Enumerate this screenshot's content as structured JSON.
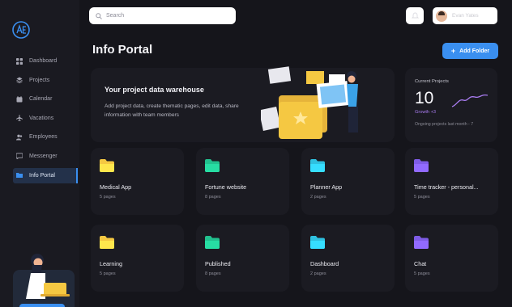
{
  "app": {
    "logo_text": "AE"
  },
  "sidebar": {
    "items": [
      {
        "label": "Dashboard",
        "icon": "grid-icon",
        "active": false
      },
      {
        "label": "Projects",
        "icon": "layers-icon",
        "active": false
      },
      {
        "label": "Calendar",
        "icon": "calendar-icon",
        "active": false
      },
      {
        "label": "Vacations",
        "icon": "airplane-icon",
        "active": false
      },
      {
        "label": "Employees",
        "icon": "users-icon",
        "active": false
      },
      {
        "label": "Messenger",
        "icon": "chat-icon",
        "active": false
      },
      {
        "label": "Info Portal",
        "icon": "folder-icon",
        "active": true
      }
    ]
  },
  "header": {
    "search_placeholder": "Search",
    "user_name": "Evan Yates"
  },
  "main": {
    "title": "Info Portal",
    "add_folder_label": "Add Folder"
  },
  "hero": {
    "title": "Your project data warehouse",
    "description": "Add project data, create thematic pages, edit data, share information with team members"
  },
  "stats": {
    "label": "Current Projects",
    "value": "10",
    "growth": "Growth +3",
    "subtext": "Ongoing projects last month - 7"
  },
  "folders": [
    {
      "title": "Medical App",
      "pages": "5 pages",
      "color": "#f5c842"
    },
    {
      "title": "Fortune website",
      "pages": "8 pages",
      "color": "#22c08e"
    },
    {
      "title": "Planner App",
      "pages": "2 pages",
      "color": "#2fc1e0"
    },
    {
      "title": "Time tracker - personal...",
      "pages": "5 pages",
      "color": "#7e5ce6"
    },
    {
      "title": "Learning",
      "pages": "5 pages",
      "color": "#f5c842"
    },
    {
      "title": "Published",
      "pages": "8 pages",
      "color": "#22c08e"
    },
    {
      "title": "Dashboard",
      "pages": "2 pages",
      "color": "#2fc1e0"
    },
    {
      "title": "Chat",
      "pages": "5 pages",
      "color": "#7e5ce6"
    }
  ],
  "colors": {
    "accent": "#3a8ff0",
    "background": "#15151b",
    "card": "#1b1b22"
  }
}
